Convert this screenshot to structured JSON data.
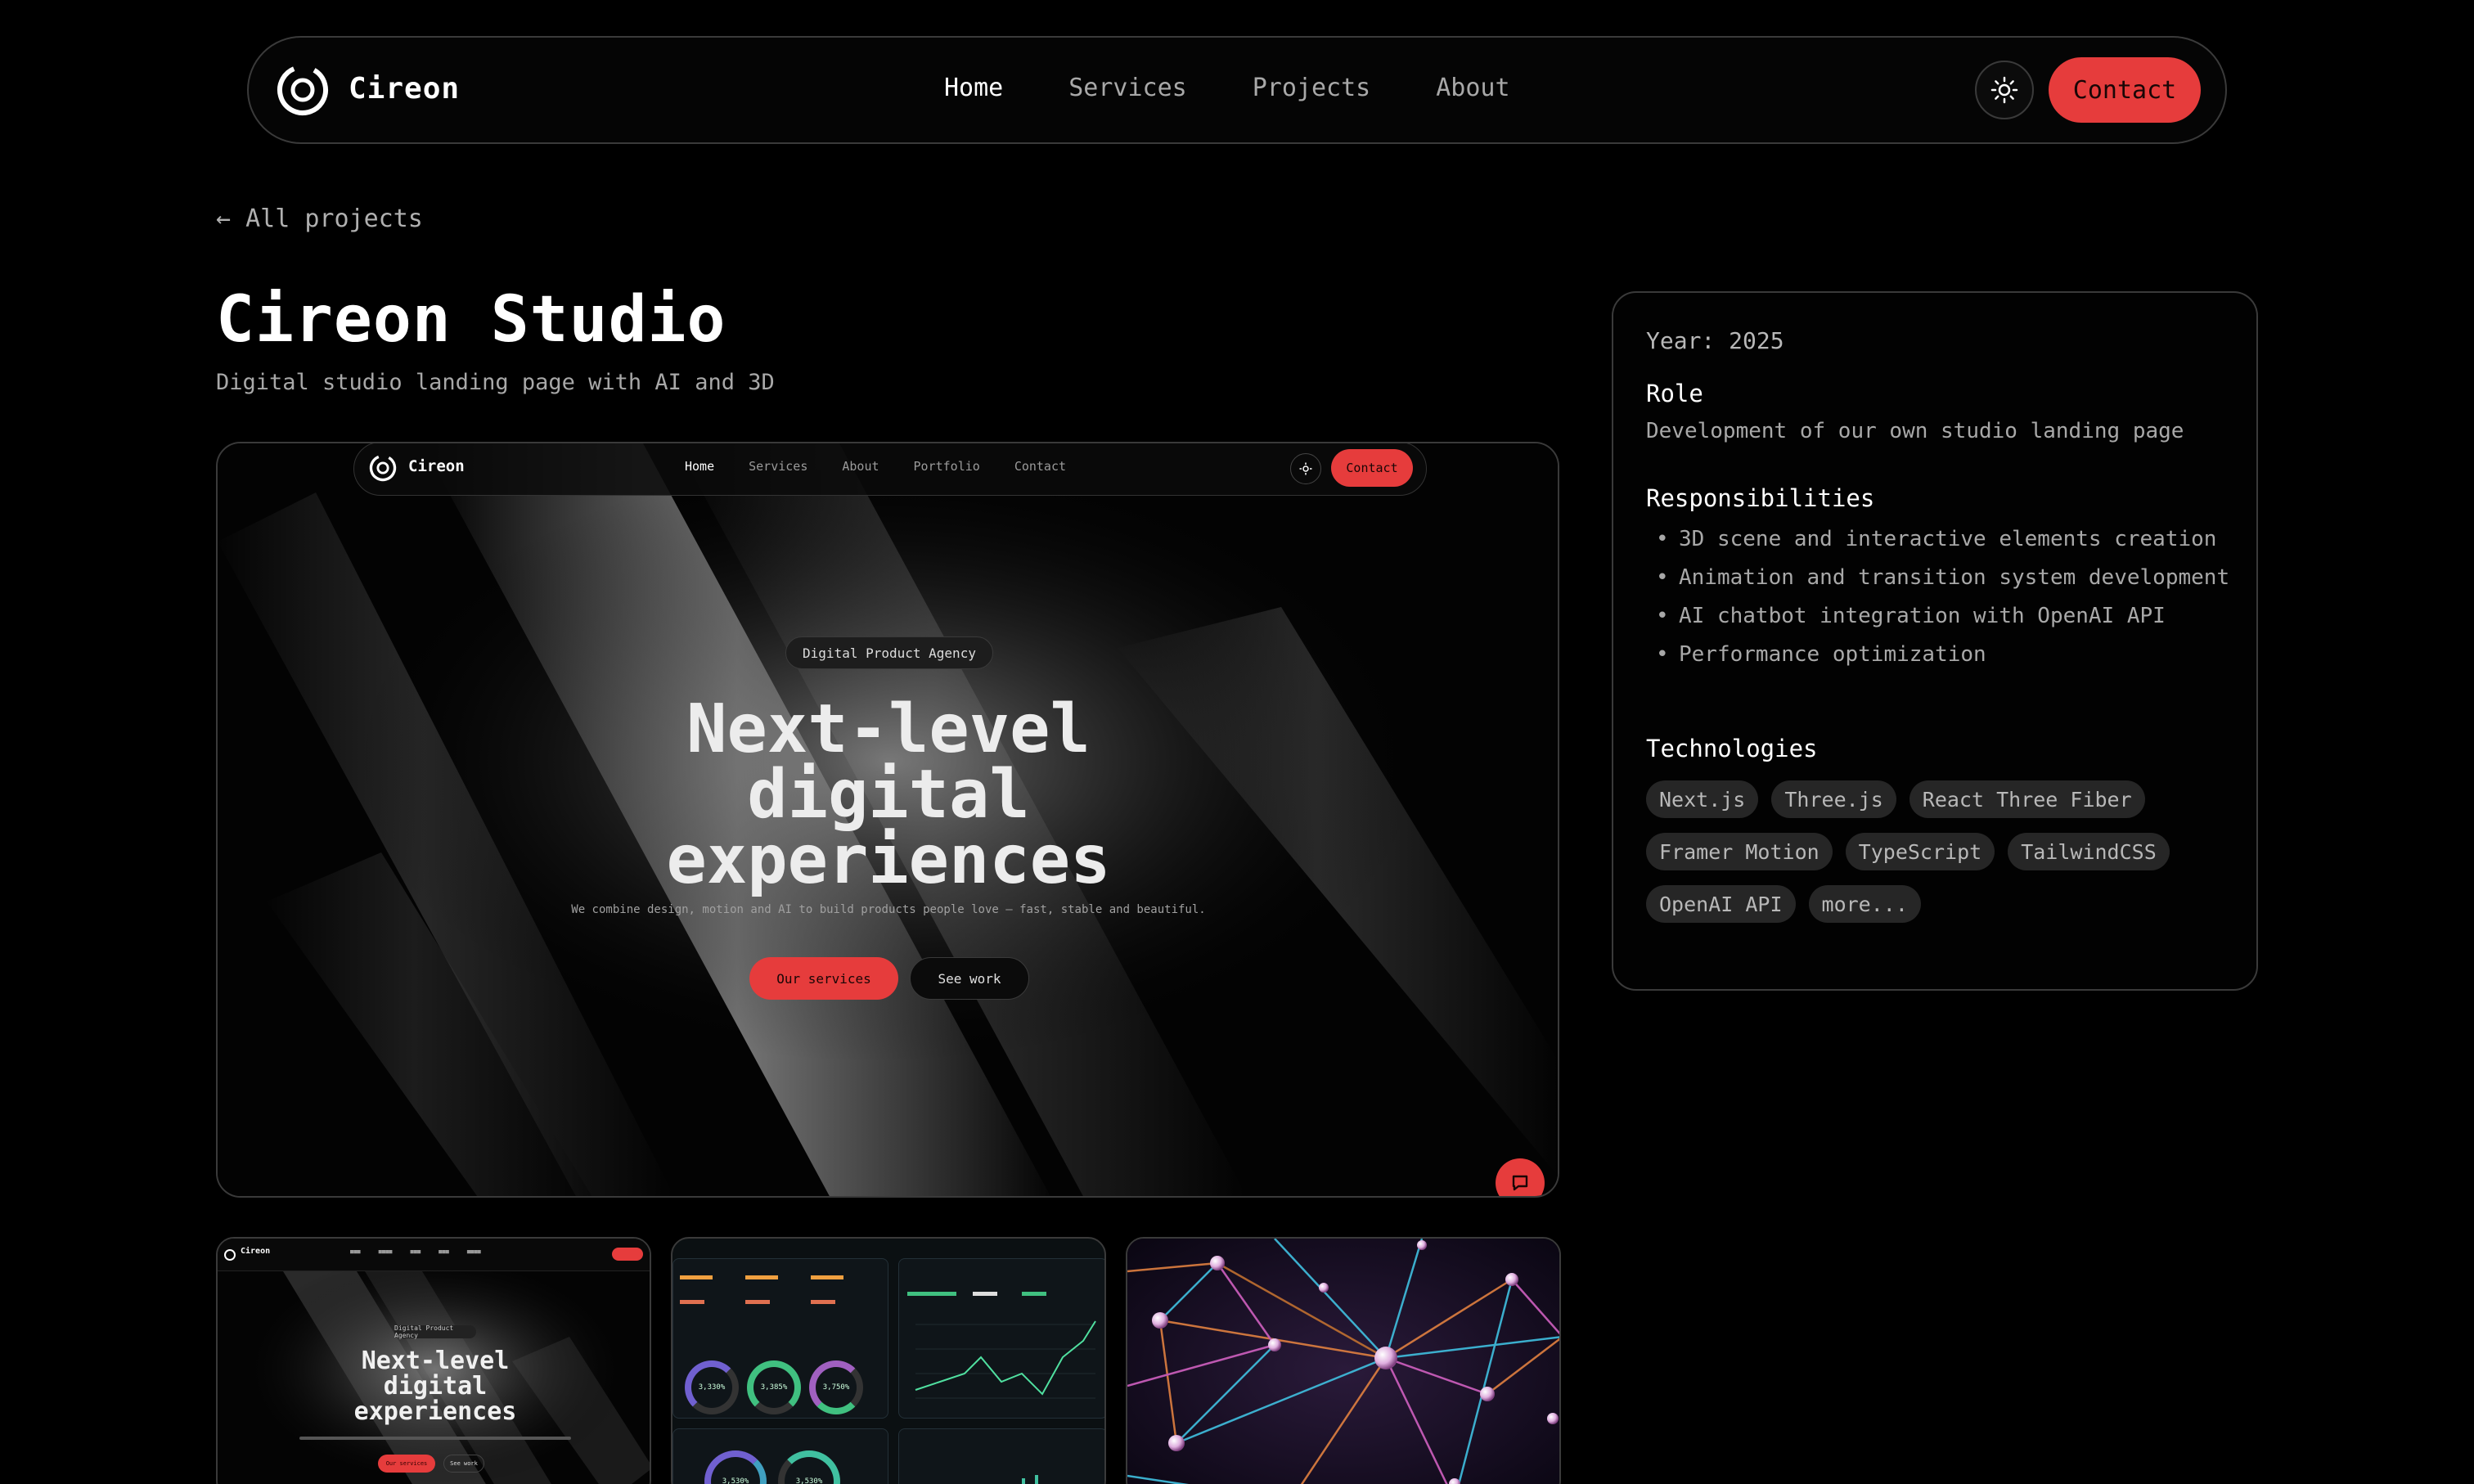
{
  "nav": {
    "brand": "Cireon",
    "links": [
      "Home",
      "Services",
      "Projects",
      "About"
    ],
    "active": "Home",
    "contact": "Contact",
    "theme_icon": "sun-icon"
  },
  "back_link": "← All projects",
  "project": {
    "title": "Cireon Studio",
    "subtitle": "Digital studio landing page with AI and 3D"
  },
  "preview": {
    "brand": "Cireon",
    "links": [
      "Home",
      "Services",
      "About",
      "Portfolio",
      "Contact"
    ],
    "contact": "Contact",
    "badge": "Digital Product Agency",
    "headline": [
      "Next-level",
      "digital",
      "experiences"
    ],
    "description": "We combine design, motion and AI to build products people love — fast, stable and beautiful.",
    "primary_button": "Our services",
    "secondary_button": "See work",
    "chat_icon": "chat-icon"
  },
  "thumbnails": {
    "first": {
      "brand": "Cireon",
      "badge": "Digital Product Agency",
      "headline": [
        "Next-level",
        "digital",
        "experiences"
      ],
      "primary_button": "Our services",
      "secondary_button": "See work"
    },
    "second": {
      "rings": [
        "3,330%",
        "3,385%",
        "3,750%",
        "3,530%",
        "3,530%"
      ]
    }
  },
  "info": {
    "year": "Year: 2025",
    "role_heading": "Role",
    "role_text": "Development of our own studio landing page",
    "responsibilities_heading": "Responsibilities",
    "responsibilities": [
      "3D scene and interactive elements creation",
      "Animation and transition system development",
      "AI chatbot integration with OpenAI API",
      "Performance optimization"
    ],
    "technologies_heading": "Technologies",
    "technologies": [
      "Next.js",
      "Three.js",
      "React Three Fiber",
      "Framer Motion",
      "TypeScript",
      "TailwindCSS",
      "OpenAI API",
      "more..."
    ]
  },
  "colors": {
    "accent": "#e63c3c",
    "background": "#000000",
    "border": "#3a3a3a",
    "muted_text": "#a8a8a8"
  }
}
